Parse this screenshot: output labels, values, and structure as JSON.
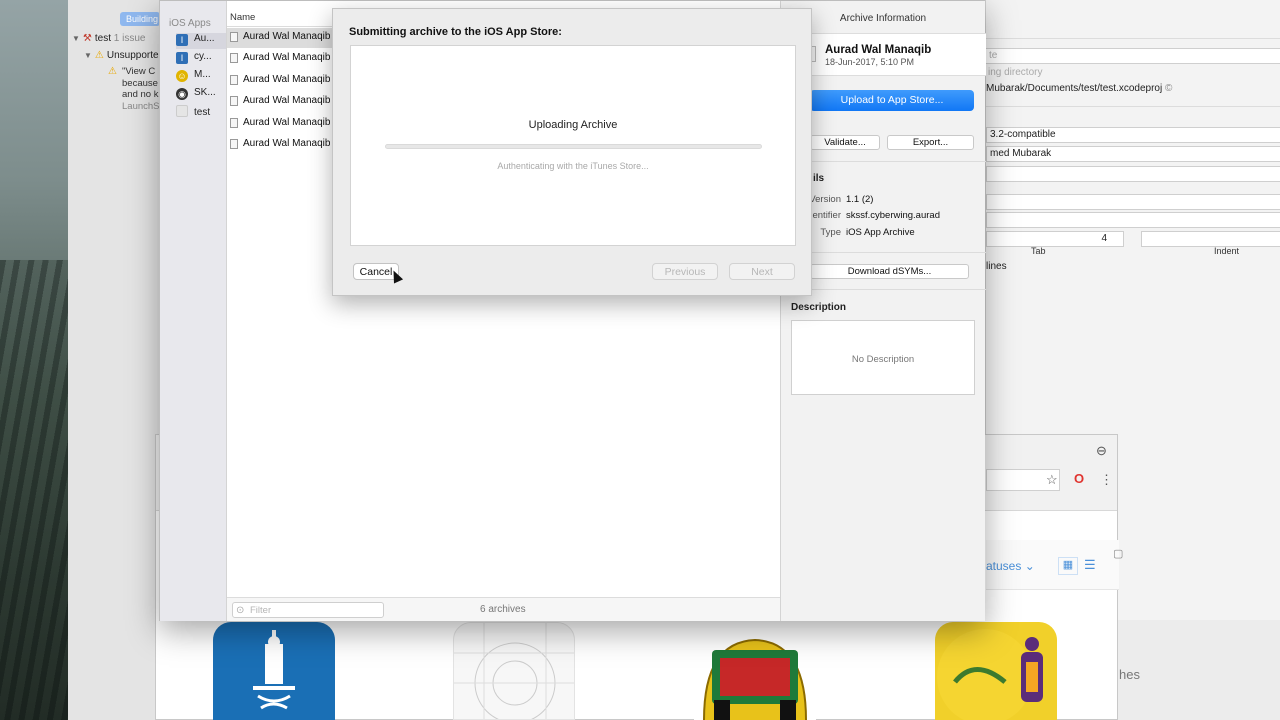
{
  "navigator": {
    "building_label": "Building",
    "project": "test",
    "issue_count": "1 issue",
    "group": "Unsupported",
    "issue_lines": [
      "\"View C",
      "because",
      "and no k",
      "LaunchS"
    ]
  },
  "organizer": {
    "sidebar_header": "iOS Apps",
    "apps": [
      {
        "label": "Au...",
        "icon": "app-icon-aurad",
        "color": "#2f6fb6"
      },
      {
        "label": "cy...",
        "icon": "app-icon-cy",
        "color": "#2f6fb6"
      },
      {
        "label": "M...",
        "icon": "app-icon-m",
        "color": "#e1b400"
      },
      {
        "label": "SK...",
        "icon": "app-icon-sk",
        "color": "#333333"
      },
      {
        "label": "test",
        "icon": "app-icon-test",
        "color": "#cfcfcf"
      }
    ],
    "list_header": "Name",
    "archives": [
      "Aurad Wal Manaqib",
      "Aurad Wal Manaqib",
      "Aurad Wal Manaqib",
      "Aurad Wal Manaqib",
      "Aurad Wal Manaqib",
      "Aurad Wal Manaqib"
    ],
    "filter_placeholder": "Filter",
    "archive_count": "6 archives",
    "info": {
      "title": "Archive Information",
      "name": "Aurad Wal Manaqib",
      "date": "18-Jun-2017, 5:10 PM",
      "upload_button": "Upload to App Store...",
      "validate_button": "Validate...",
      "export_button": "Export...",
      "details_label": "ils",
      "version_key": "Version",
      "version_val": "1.1 (2)",
      "identifier_key": "entifier",
      "identifier_val": "skssf.cyberwing.aurad",
      "type_key": "Type",
      "type_val": "iOS App Archive",
      "dsyms_button": "Download dSYMs...",
      "description_label": "Description",
      "description_empty": "No Description"
    }
  },
  "sheet": {
    "title": "Submitting archive to the iOS App Store:",
    "status": "Uploading Archive",
    "progress": 0,
    "substatus": "Authenticating with the iTunes Store...",
    "cancel": "Cancel",
    "previous": "Previous",
    "next": "Next"
  },
  "inspector": {
    "lines": [
      {
        "text": "te",
        "kind": "label"
      },
      {
        "text": "ing directory",
        "kind": "muted"
      },
      {
        "text": "Mubarak/Documents/test/test.xcodeproj",
        "kind": "field"
      },
      {
        "text": "3.2-compatible",
        "kind": "field"
      },
      {
        "text": "med Mubarak",
        "kind": "field"
      }
    ],
    "tab_value": "4",
    "tab_label": "Tab",
    "indent_label": "Indent",
    "lines_label": "lines"
  },
  "browser": {
    "statuses_label": "atuses",
    "partial_text": "hes"
  }
}
